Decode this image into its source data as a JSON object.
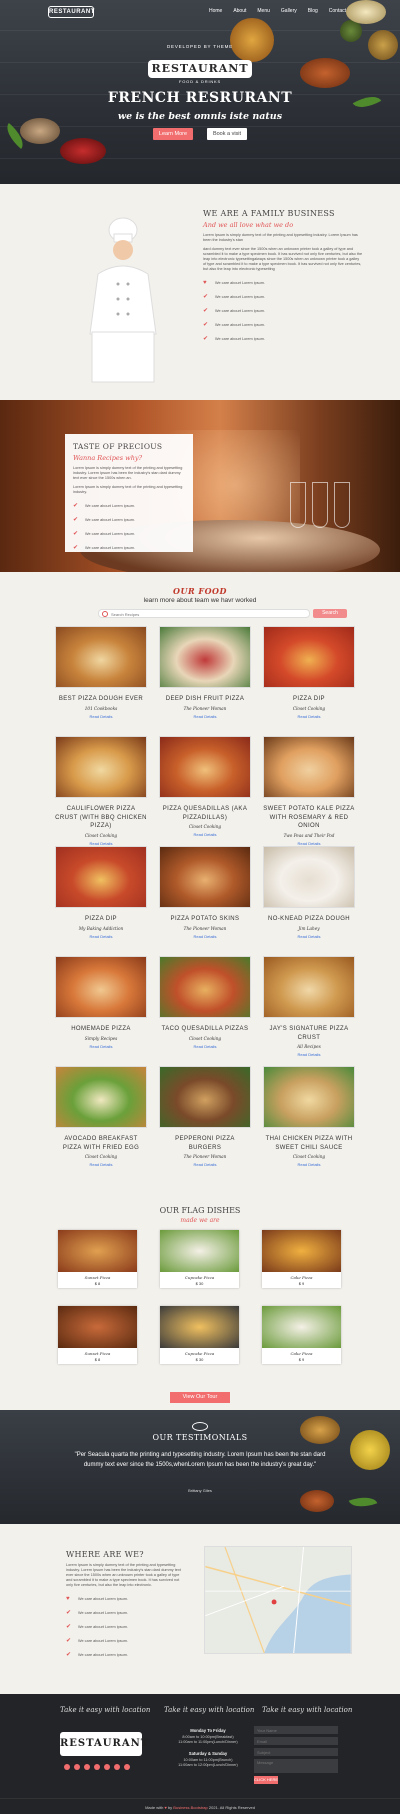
{
  "nav": {
    "logo": "RESTAURANT",
    "links": [
      "Home",
      "About",
      "Menu",
      "Gallery",
      "Blog",
      "Contact"
    ]
  },
  "hero": {
    "emblem_top": "DEVELOPED BY THEME",
    "emblem_main": "RESTAURANT",
    "emblem_sub": "FOOD & DRINKS",
    "title": "FRENCH RESRURANT",
    "tagline": "we is the best omnis iste natus",
    "learn_more": "Learn More",
    "book_visit": "Book a visit"
  },
  "family": {
    "heading": "WE ARE A FAMILY BUSINESS",
    "script": "And we all love what we do",
    "para1": "Lorem Ipsum is simply dummy text of the printing and typesetting industry. Lorem Ipsum has been the industry's stan",
    "para2": "dard dummy text ever since the 1500s when an unknown printer took a galley of type and scrambled it to make a type specimen book. It has survived not only five centuries, but also the leap into electronic typesettingalways since the 1500s when an unknown printer took a galley of type and scrambled it to make a type specimen book. It has survived not only five centuries, but also the leap into electronic typesetting",
    "checks": [
      "We care abourt Lorem ipsum.",
      "We care abourt Lorem ipsum.",
      "We care abourt Lorem ipsum.",
      "We care abourt Lorem ipsum.",
      "We care abourt Lorem ipsum."
    ]
  },
  "taste": {
    "heading": "TASTE OF PRECIOUS",
    "script": "Wanna Recipes why?",
    "para1": "Lorem Ipsum is simply dummy text of the printing and typesetting industry. Lorem Ipsum has been the industry's stan dard dummy text ever since the 1500s when an.",
    "para2": "Lorem Ipsum is simply dummy text of the printing and typesetting industry.",
    "checks": [
      "We care abourt Lorem ipsum.",
      "We care abourt Lorem ipsum.",
      "We care abourt Lorem ipsum.",
      "We care abourt Lorem ipsum."
    ]
  },
  "food": {
    "title": "OUR FOOD",
    "subtitle": "learn more about team we havr worked",
    "search_placeholder": "Search Recipes",
    "search_button": "Search",
    "link_label": "Read Details",
    "items": [
      {
        "name": "BEST PIZZA DOUGH EVER",
        "author": "101 Cookbooks"
      },
      {
        "name": "DEEP DISH FRUIT PIZZA",
        "author": "The Pioneer Woman"
      },
      {
        "name": "PIZZA DIP",
        "author": "Closet Cooking"
      },
      {
        "name": "CAULIFLOWER PIZZA CRUST (WITH BBQ CHICKEN PIZZA)",
        "author": "Closet Cooking"
      },
      {
        "name": "PIZZA QUESADILLAS (AKA PIZZADILLAS)",
        "author": "Closet Cooking"
      },
      {
        "name": "SWEET POTATO KALE PIZZA WITH ROSEMARY & RED ONION",
        "author": "Two Peas and Their Pod"
      },
      {
        "name": "PIZZA DIP",
        "author": "My Baking Addiction"
      },
      {
        "name": "PIZZA POTATO SKINS",
        "author": "The Pioneer Woman"
      },
      {
        "name": "NO-KNEAD PIZZA DOUGH",
        "author": "Jim Lahey"
      },
      {
        "name": "HOMEMADE PIZZA",
        "author": "Simply Recipes"
      },
      {
        "name": "TACO QUESADILLA PIZZAS",
        "author": "Closet Cooking"
      },
      {
        "name": "JAY'S SIGNATURE PIZZA CRUST",
        "author": "All Recipes"
      },
      {
        "name": "AVOCADO BREAKFAST PIZZA WITH FRIED EGG",
        "author": "Closet Cooking"
      },
      {
        "name": "PEPPERONI PIZZA BURGERS",
        "author": "The Pioneer Woman"
      },
      {
        "name": "THAI CHICKEN PIZZA WITH SWEET CHILI SAUCE",
        "author": "Closet Cooking"
      }
    ]
  },
  "flag": {
    "title": "OUR FLAG DISHES",
    "subtitle": "made we are",
    "dishes": [
      {
        "name": "Sunset Pizza",
        "price": "$ 8"
      },
      {
        "name": "Cupcake Pizza",
        "price": "$ 30"
      },
      {
        "name": "Cake Pizza",
        "price": "$ 9"
      },
      {
        "name": "Sunset Pizza",
        "price": "$ 8"
      },
      {
        "name": "Cupcake Pizza",
        "price": "$ 30"
      },
      {
        "name": "Cake Pizza",
        "price": "$ 9"
      }
    ],
    "button": "View Our Tour"
  },
  "testimonials": {
    "title": "OUR TESTIMONIALS",
    "quote": "\"Per Seacula quarta the printing and typesetting industry. Lorem Ipsum has been the stan dard dummy text ever since the 1500s,whenLorem Ipsum has been the industry's great day.\"",
    "author": "Brittany Giles"
  },
  "where": {
    "heading": "WHERE ARE WE?",
    "para": "Lorem Ipsum is simply dummy text of the printing and typesetting industry. Lorem Ipsum has been the industry's stan dard dummy text ever since the 1500s when an unknown printer took a galley of type and scrambled it to make a type specimen book. It has survived not only five centuries, but also the leap into electronic.",
    "checks": [
      "We care abourt Lorem ipsum.",
      "We care abourt Lorem ipsum.",
      "We care abourt Lorem ipsum.",
      "We care abourt Lorem ipsum.",
      "We care abourt Lorem ipsum."
    ]
  },
  "footer": {
    "script1": "Take it easy with location",
    "script2": "Take it easy with location",
    "script3": "Take it easy with location",
    "logo": "RESTAURANT",
    "hours": [
      {
        "day": "Monday To Friday",
        "times": [
          "8:00am to 10:00pm(Breakfast)",
          "11:00am to 11:00pm(Lunch/Dinner)"
        ]
      },
      {
        "day": "Saturday & Sunday",
        "times": [
          "10:00am to 11:00pm(Brunch)",
          "11:00am to 12:00pm(Lunch/Dinner)"
        ]
      }
    ],
    "form": {
      "name": "Your Name",
      "email": "Email",
      "subject": "Subject",
      "message": "Message",
      "send": "CLICK HERE"
    },
    "copyright_prefix": "Made with",
    "copyright_by": "by",
    "copyright_brand": "Business.Bootstrap",
    "copyright_suffix": "2021. All Rights Reserved"
  }
}
